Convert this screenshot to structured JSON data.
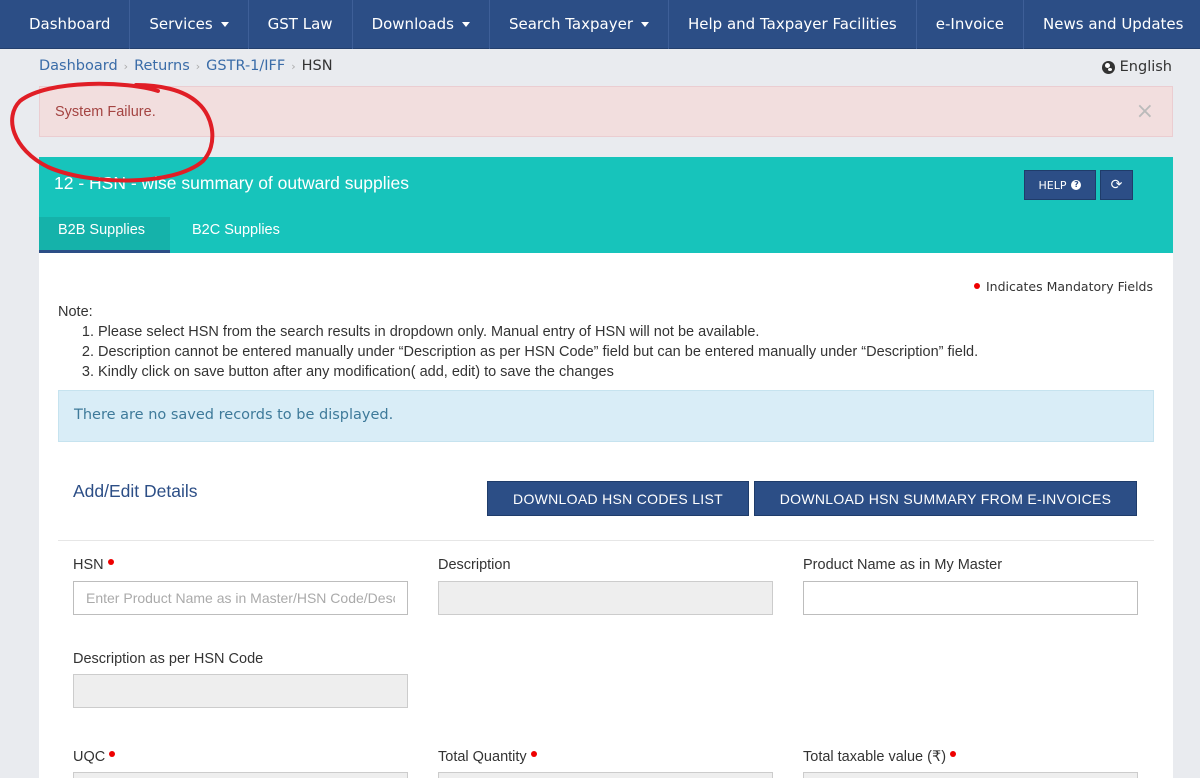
{
  "nav": {
    "items": [
      {
        "label": "Dashboard",
        "dropdown": false
      },
      {
        "label": "Services",
        "dropdown": true
      },
      {
        "label": "GST Law",
        "dropdown": false
      },
      {
        "label": "Downloads",
        "dropdown": true
      },
      {
        "label": "Search Taxpayer",
        "dropdown": true
      },
      {
        "label": "Help and Taxpayer Facilities",
        "dropdown": false
      },
      {
        "label": "e-Invoice",
        "dropdown": false
      },
      {
        "label": "News and Updates",
        "dropdown": false
      }
    ]
  },
  "breadcrumb": {
    "items": [
      "Dashboard",
      "Returns",
      "GSTR-1/IFF"
    ],
    "current": "HSN"
  },
  "language": "English",
  "alert": {
    "message": "System Failure.",
    "close": "×"
  },
  "panel": {
    "title": "12 - HSN - wise summary of outward supplies",
    "help_label": "HELP",
    "help_icon": "question-circle-icon",
    "refresh_icon": "refresh-icon",
    "tabs": [
      "B2B Supplies",
      "B2C Supplies"
    ],
    "active_tab": "B2B Supplies"
  },
  "mandatory_note": "Indicates Mandatory Fields",
  "note": {
    "heading": "Note:",
    "items": [
      "Please select HSN from the search results in dropdown only. Manual entry of HSN will not be available.",
      "Description cannot be entered manually under “Description as per HSN Code” field but can be entered manually under “Description” field.",
      "Kindly click on save button after any modification( add, edit) to save the changes"
    ]
  },
  "info": "There are no saved records to be displayed.",
  "section_title": "Add/Edit Details",
  "buttons": {
    "download_hsn": "DOWNLOAD HSN CODES LIST",
    "download_einvoice": "DOWNLOAD HSN SUMMARY FROM E-INVOICES"
  },
  "form": {
    "hsn_label": "HSN",
    "hsn_placeholder": "Enter Product Name as in Master/HSN Code/Description",
    "description_label": "Description",
    "product_name_label": "Product Name as in My Master",
    "desc_hsn_label": "Description as per HSN Code",
    "uqc_label": "UQC",
    "total_qty_label": "Total Quantity",
    "taxable_label": "Total taxable value (₹)"
  },
  "colors": {
    "nav_bg": "#2c4e86",
    "panel_teal": "#17c4bb",
    "alert_bg": "#f2dede",
    "alert_text": "#a44442",
    "info_bg": "#d9edf7",
    "mandatory_dot": "#ee0000",
    "annotation": "#e01e26"
  }
}
